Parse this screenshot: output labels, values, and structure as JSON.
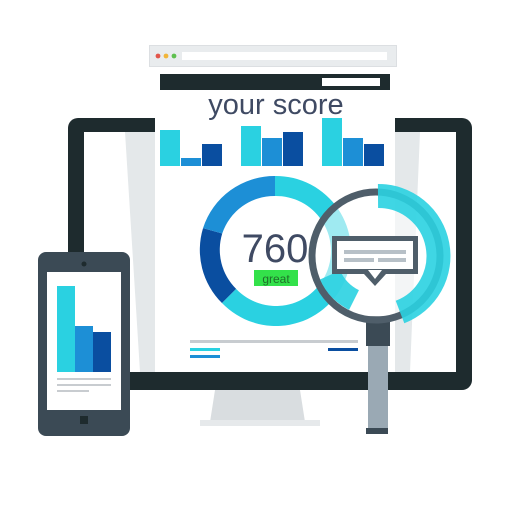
{
  "title": "your score",
  "score": "760",
  "rating": "great",
  "colors": {
    "frame": "#1e2b2e",
    "cyan": "#2ad1e1",
    "mid_blue": "#1d8fd6",
    "dark_blue": "#0a4ea0",
    "green": "#33e14a",
    "grey": "#c8ccd0",
    "text": "#3f4a63"
  },
  "icons": {
    "magnifier": "magnifying-glass-icon",
    "tooltip": "speech-bubble-icon",
    "phone": "smartphone-icon",
    "monitor": "desktop-monitor-icon",
    "browser": "browser-window-icon"
  }
}
